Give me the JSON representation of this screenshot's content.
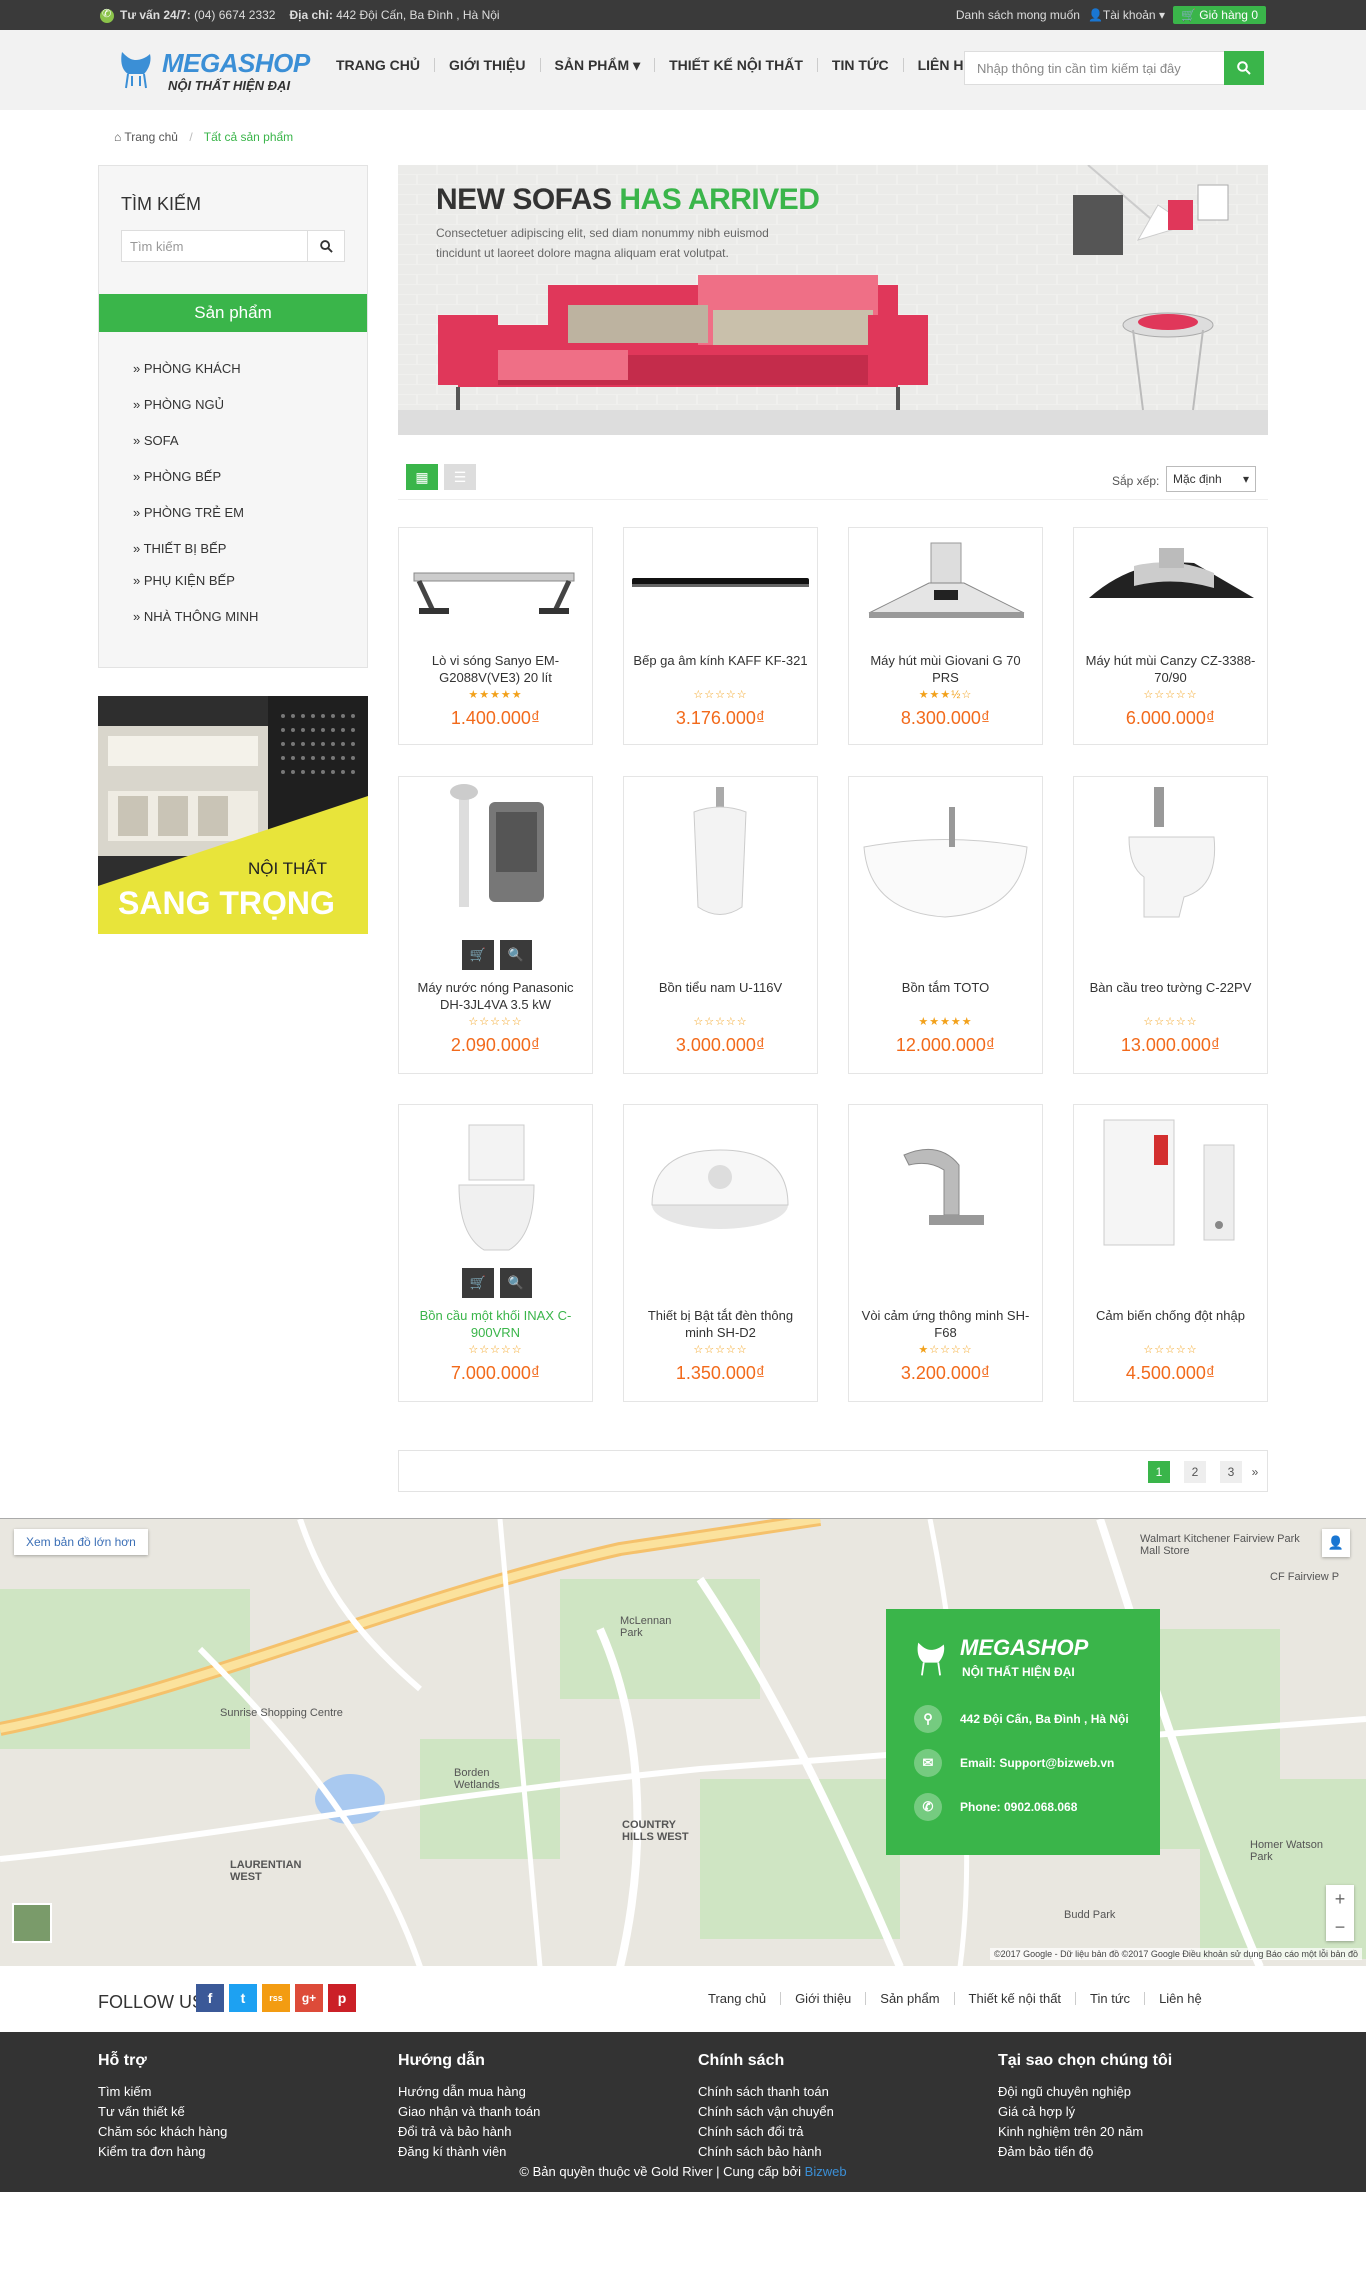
{
  "topbar": {
    "hotline_label": "Tư vấn 24/7:",
    "hotline": "(04) 6674 2332",
    "address_label": "Địa chỉ:",
    "address": "442 Đội Cấn, Ba Đình , Hà Nội",
    "wishlist": "Danh sách mong muốn",
    "account": "Tài khoản",
    "cart": "Giỏ hàng 0"
  },
  "header": {
    "logo_name": "MEGASHOP",
    "logo_tagline": "NỘI THẤT HIỆN ĐẠI",
    "nav": [
      "TRANG CHỦ",
      "GIỚI THIỆU",
      "SẢN PHẨM",
      "THIẾT KẾ NỘI THẤT",
      "TIN TỨC",
      "LIÊN HỆ"
    ],
    "search_placeholder": "Nhập thông tin cần tìm kiếm tại đây"
  },
  "breadcrumb": {
    "home": "Trang chủ",
    "current": "Tất cả sản phẩm"
  },
  "sidebar": {
    "search_title": "TÌM KIẾM",
    "search_placeholder": "Tìm kiếm",
    "category_head": "Sản phẩm",
    "categories": [
      "» PHÒNG KHÁCH",
      "» PHÒNG NGỦ",
      "» SOFA",
      "» PHÒNG BẾP",
      "» PHÒNG TRẺ EM",
      "» THIẾT BỊ BẾP",
      "» PHỤ KIỆN BẾP",
      "» NHÀ THÔNG MINH"
    ],
    "promo_line1": "NỘI THẤT",
    "promo_line2": "SANG TRỌNG"
  },
  "banner": {
    "title_black": "NEW SOFAS",
    "title_green": "HAS ARRIVED",
    "desc": "Consectetuer adipiscing elit, sed diam nonummy nibh euismod tincidunt ut laoreet dolore magna aliquam erat volutpat."
  },
  "toolbar": {
    "sort_label": "Sắp xếp:",
    "sort_value": "Mặc định"
  },
  "products": [
    {
      "name": "Lò vi sóng Sanyo EM-G2088V(VE3) 20 lít",
      "price": "1.400.000₫",
      "stars": "★★★★★",
      "rating": 5
    },
    {
      "name": "Bếp ga âm kính KAFF KF-321",
      "price": "3.176.000₫",
      "stars": "☆☆☆☆☆",
      "rating": 0
    },
    {
      "name": "Máy hút mùi Giovani G 70 PRS",
      "price": "8.300.000₫",
      "stars": "★★★½☆",
      "rating": 3.5
    },
    {
      "name": "Máy hút mùi Canzy CZ-3388-70/90",
      "price": "6.000.000₫",
      "stars": "☆☆☆☆☆",
      "rating": 0
    },
    {
      "name": "Máy nước nóng Panasonic DH-3JL4VA 3.5 kW",
      "price": "2.090.000₫",
      "stars": "☆☆☆☆☆",
      "rating": 0
    },
    {
      "name": "Bồn tiểu nam U-116V",
      "price": "3.000.000₫",
      "stars": "☆☆☆☆☆",
      "rating": 0
    },
    {
      "name": "Bồn tắm TOTO",
      "price": "12.000.000₫",
      "stars": "★★★★★",
      "rating": 5
    },
    {
      "name": "Bàn cầu treo tường C-22PV",
      "price": "13.000.000₫",
      "stars": "☆☆☆☆☆",
      "rating": 0
    },
    {
      "name": "Bồn cầu một khối INAX C-900VRN",
      "price": "7.000.000₫",
      "stars": "☆☆☆☆☆",
      "rating": 0
    },
    {
      "name": "Thiết bị Bật tắt đèn thông minh SH-D2",
      "price": "1.350.000₫",
      "stars": "☆☆☆☆☆",
      "rating": 0
    },
    {
      "name": "Vòi cảm ứng thông minh SH-F68",
      "price": "3.200.000₫",
      "stars": "★☆☆☆☆",
      "rating": 1
    },
    {
      "name": "Cảm biến chống đột nhập",
      "price": "4.500.000₫",
      "stars": "☆☆☆☆☆",
      "rating": 0
    }
  ],
  "pagination": {
    "pages": [
      "1",
      "2",
      "3"
    ],
    "next": "»",
    "active": "1"
  },
  "map": {
    "view_larger": "Xem bản đồ lớn hơn",
    "labels": [
      "Sunrise Shopping Centre",
      "Walmart Kitchener Fairview Park Mall Store",
      "CF Fairview P",
      "McLennan Park",
      "Borden Wetlands",
      "COUNTRY HILLS WEST",
      "LAURENTIAN WEST",
      "Budd Park",
      "Homer Watson Park"
    ],
    "copyright": "©2017 Google - Dữ liệu bản đồ ©2017 Google   Điều khoản sử dụng   Báo cáo một lỗi bản đồ",
    "card_name": "MEGASHOP",
    "card_tagline": "NỘI THẤT HIỆN ĐẠI",
    "card_address": "442 Đội Cấn, Ba Đình , Hà Nội",
    "card_email": "Email: Support@bizweb.vn",
    "card_phone": "Phone: 0902.068.068"
  },
  "follow": {
    "label": "FOLLOW US",
    "socials": [
      "f",
      "t",
      "rss",
      "g+",
      "p"
    ],
    "links": [
      "Trang chủ",
      "Giới thiệu",
      "Sản phẩm",
      "Thiết kế nội thất",
      "Tin tức",
      "Liên hệ"
    ]
  },
  "footer": {
    "columns": [
      {
        "title": "Hỗ trợ",
        "links": [
          "Tìm kiếm",
          "Tư vấn thiết kế",
          "Chăm sóc khách hàng",
          "Kiểm tra đơn hàng"
        ]
      },
      {
        "title": "Hướng dẫn",
        "links": [
          "Hướng dẫn mua hàng",
          "Giao nhận và thanh toán",
          "Đổi trả và bảo hành",
          "Đăng kí thành viên"
        ]
      },
      {
        "title": "Chính sách",
        "links": [
          "Chính sách thanh toán",
          "Chính sách vận chuyển",
          "Chính sách đổi trả",
          "Chính sách bảo hành"
        ]
      },
      {
        "title": "Tại sao chọn chúng tôi",
        "links": [
          "Đội ngũ chuyên nghiệp",
          "Giá cả hợp lý",
          "Kinh nghiệm trên 20 năm",
          "Đảm bảo tiến độ"
        ]
      }
    ],
    "copyright": "© Bản quyền thuộc về Gold River | Cung cấp bởi",
    "provider": "Bizweb"
  },
  "colors": {
    "accent": "#3ab54a",
    "brand_blue": "#3b8fd6",
    "price": "#f26a1b",
    "dark": "#333333"
  }
}
